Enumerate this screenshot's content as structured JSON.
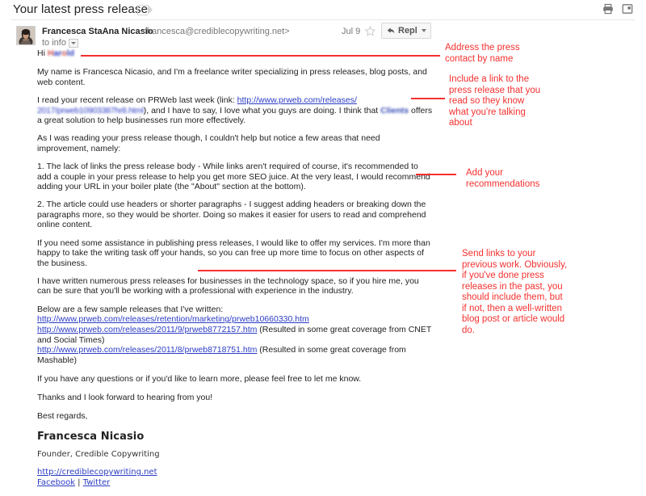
{
  "header": {
    "subject": "Your latest press release",
    "tag_icon": "label-tag-icon",
    "print_icon": "print-icon",
    "popout_icon": "open-in-new-window-icon"
  },
  "message": {
    "avatar": "sender-avatar",
    "sender_name": "Francesca StaAna Nicasio",
    "sender_email": "<francesca@crediblecopywriting.net>",
    "to_line": "to info",
    "date": "Jul 9",
    "star_icon": "star-icon",
    "reply_label": "Reply",
    "reply_arrow_icon": "reply-arrow-icon",
    "more_options_icon": "chevron-down-icon"
  },
  "body": {
    "greeting_prefix": "Hi ",
    "greeting_name_redacted": "Harold",
    "paragraph_1": "My name is Francesca Nicasio, and I'm a freelance writer specializing in press releases, blog posts, and web content.",
    "paragraph_2_a": "I read your recent release on PRWeb last week (link: ",
    "paragraph_2_link_visible": "http://www.prweb.com/releases/",
    "paragraph_2_link_redacted": "2017/prweb10903387hr8.html",
    "paragraph_2_b": "), and I have to say, I love what you guys are doing. I think that ",
    "paragraph_2_company_redacted": "Clients",
    "paragraph_2_c": " offers a great solution to help businesses run more effectively.",
    "paragraph_3": "As I was reading your press release though, I couldn't help but notice a few areas that need improvement, namely:",
    "paragraph_4": "1. The lack of links the press release body - While links aren't required of course, it's recommended to add a couple in your press release to help you get more SEO juice. At the very least, I would recommend adding your URL in your boiler plate (the \"About\" section at the bottom).",
    "paragraph_5": "2. The article could use headers or shorter paragraphs - I suggest adding headers or breaking down the paragraphs more, so they would be shorter. Doing so makes it easier for users to read and comprehend online content.",
    "paragraph_6": "If you need some assistance in publishing press releases, I would like to offer my services. I'm more than happy to take the writing task off your hands, so you can free up more time to focus on other aspects of the business.",
    "paragraph_7": "I have written numerous press releases for businesses in the technology space, so if you hire me, you can be sure that you'll be working with a professional with experience in the industry.",
    "samples_intro": "Below are a few sample releases that I've written:",
    "sample_links": [
      {
        "url": "http://www.prweb.com/releases/retention/marketing/prweb10660330.htm",
        "note": ""
      },
      {
        "url": "http://www.prweb.com/releases/2011/9/prweb8772157.htm",
        "note": " (Resulted in some great coverage from CNET and Social Times)"
      },
      {
        "url": "http://www.prweb.com/releases/2011/8/prweb8718751.htm",
        "note": " (Resulted in some great coverage from Mashable)"
      }
    ],
    "paragraph_8": "If you have any questions or if you'd like to learn more, please feel free to let me know.",
    "paragraph_9": "Thanks and I look forward to hearing from you!",
    "closing": "Best regards,",
    "signature": {
      "name": "Francesca Nicasio",
      "title": "Founder, Credible Copywriting",
      "website": "http://crediblecopywriting.net",
      "facebook": "Facebook",
      "separator": " | ",
      "twitter": "Twitter"
    }
  },
  "annotations": {
    "accent_color": "#f4312f",
    "notes": [
      {
        "text": "Address the press\ncontact by name"
      },
      {
        "text": "Include a link to the\npress release that you\nread so they know\nwhat you're talking\nabout"
      },
      {
        "text": "Add your\nrecommendations"
      },
      {
        "text": "Send links to your\nprevious work. Obviously,\nif you've done press\nreleases in the past, you\nshould include them, but\nif not, then a well-written\nblog post or article would\ndo."
      }
    ]
  }
}
